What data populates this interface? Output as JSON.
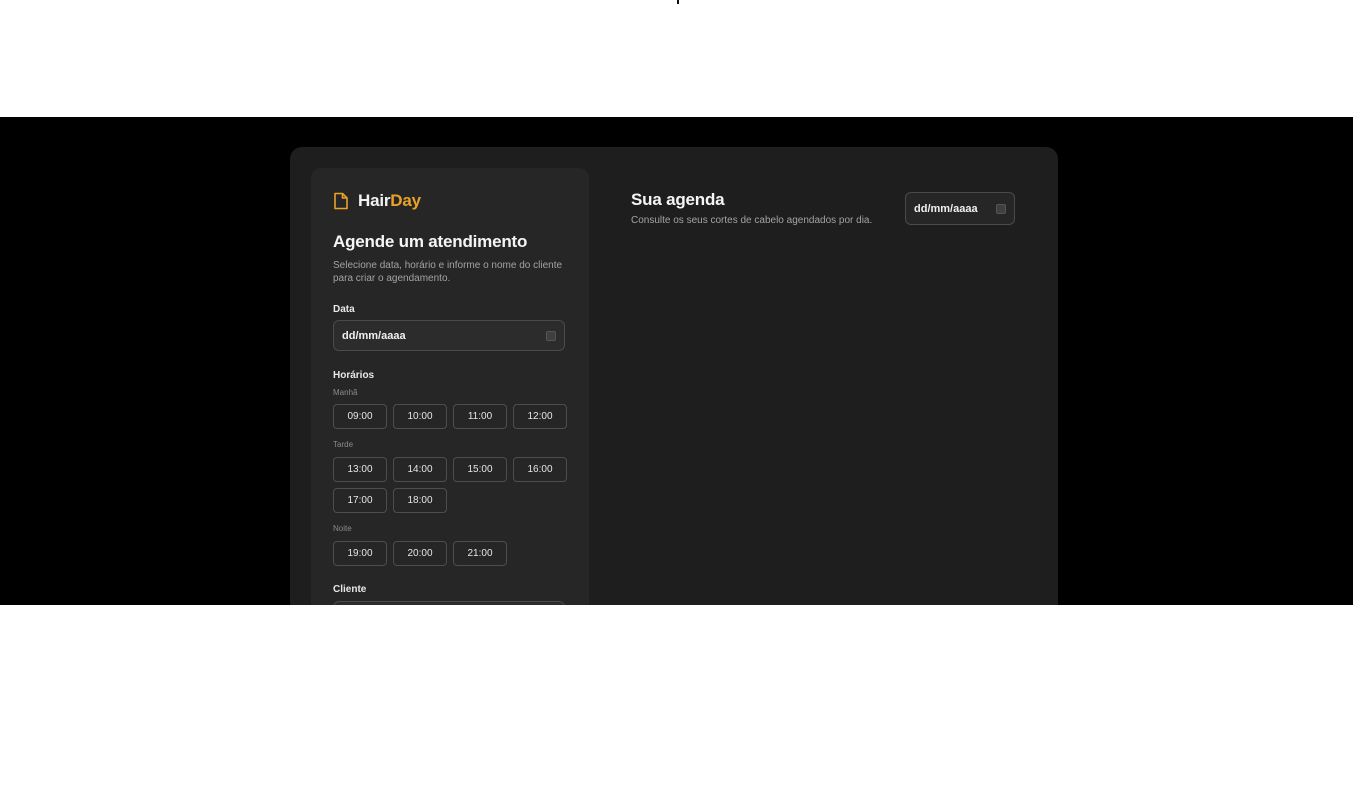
{
  "brand": {
    "name_part1": "Hair",
    "name_part2": "Day",
    "accent_color": "#e8a326",
    "icon": "file-icon"
  },
  "form": {
    "title": "Agende um atendimento",
    "description": "Selecione data, horário e informe o nome do cliente para criar o agendamento.",
    "date_label": "Data",
    "date_value": "dd/mm/aaaa",
    "schedule_label": "Horários",
    "groups": {
      "morning": {
        "label": "Manhã",
        "slots": [
          "09:00",
          "10:00",
          "11:00",
          "12:00"
        ]
      },
      "afternoon": {
        "label": "Tarde",
        "slots": [
          "13:00",
          "14:00",
          "15:00",
          "16:00",
          "17:00",
          "18:00"
        ]
      },
      "night": {
        "label": "Noite",
        "slots": [
          "19:00",
          "20:00",
          "21:00"
        ]
      }
    },
    "client_label": "Cliente"
  },
  "agenda": {
    "title": "Sua agenda",
    "description": "Consulte os seus cortes de cabelo agendados por dia.",
    "date_value": "dd/mm/aaaa"
  }
}
